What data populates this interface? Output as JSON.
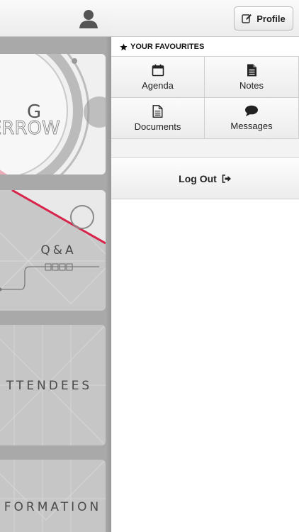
{
  "background_app": {
    "tiles": [
      {
        "label": "G"
      },
      {
        "label": "Q&A"
      },
      {
        "label": "TTENDEES"
      },
      {
        "label": "FORMATION"
      }
    ]
  },
  "menu": {
    "profile_button": {
      "label": "Profile",
      "icon": "edit-icon"
    },
    "favourites_title": "YOUR FAVOURITES",
    "favourites": [
      {
        "label": "Agenda",
        "icon": "calendar-icon"
      },
      {
        "label": "Notes",
        "icon": "file-icon"
      },
      {
        "label": "Documents",
        "icon": "document-icon"
      },
      {
        "label": "Messages",
        "icon": "chat-bubble-icon"
      }
    ],
    "logout_label": "Log Out"
  },
  "colors": {
    "accent_red": "#d8234a",
    "tile_gray": "#c4c4c4"
  }
}
